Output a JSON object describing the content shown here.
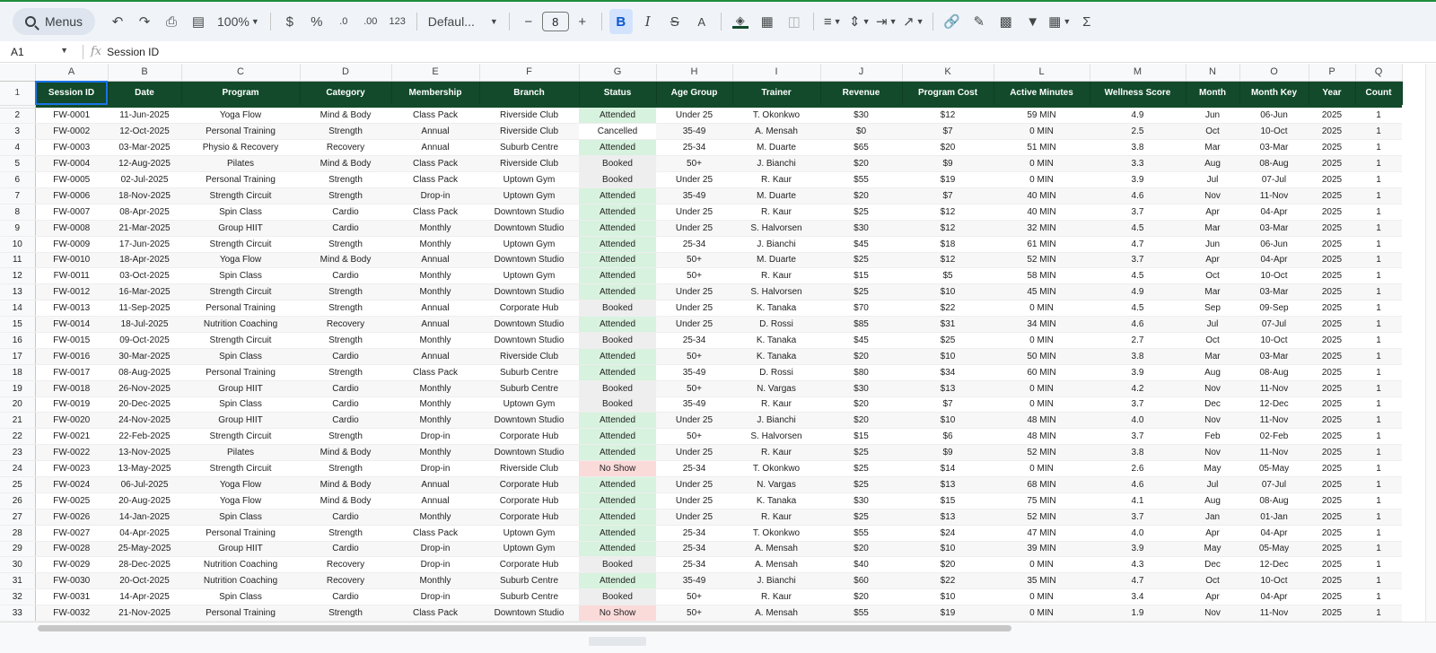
{
  "toolbar": {
    "menus_label": "Menus",
    "zoom": "100%",
    "currency": "$",
    "percent": "%",
    "dec_decrease": ".0",
    "dec_increase": ".00",
    "number_format": "123",
    "font_name": "Defaul...",
    "font_size": "8",
    "bold": "B",
    "italic": "I",
    "strike": "S",
    "text_color": "A",
    "sum": "Σ"
  },
  "formula_bar": {
    "cell_ref": "A1",
    "fx": "fx",
    "value": "Session ID"
  },
  "columns": [
    "A",
    "B",
    "C",
    "D",
    "E",
    "F",
    "G",
    "H",
    "I",
    "J",
    "K",
    "L",
    "M",
    "N",
    "O",
    "P",
    "Q"
  ],
  "headers": [
    "Session ID",
    "Date",
    "Program",
    "Category",
    "Membership",
    "Branch",
    "Status",
    "Age Group",
    "Trainer",
    "Revenue",
    "Program Cost",
    "Active Minutes",
    "Wellness Score",
    "Month",
    "Month Key",
    "Year",
    "Count"
  ],
  "rows": [
    [
      "FW-0001",
      "11-Jun-2025",
      "Yoga Flow",
      "Mind & Body",
      "Class Pack",
      "Riverside Club",
      "Attended",
      "Under 25",
      "T. Okonkwo",
      "$30",
      "$12",
      "59 MIN",
      "4.9",
      "Jun",
      "06-Jun",
      "2025",
      "1"
    ],
    [
      "FW-0002",
      "12-Oct-2025",
      "Personal Training",
      "Strength",
      "Annual",
      "Riverside Club",
      "Cancelled",
      "35-49",
      "A. Mensah",
      "$0",
      "$7",
      "0 MIN",
      "2.5",
      "Oct",
      "10-Oct",
      "2025",
      "1"
    ],
    [
      "FW-0003",
      "03-Mar-2025",
      "Physio & Recovery",
      "Recovery",
      "Annual",
      "Suburb Centre",
      "Attended",
      "25-34",
      "M. Duarte",
      "$65",
      "$20",
      "51 MIN",
      "3.8",
      "Mar",
      "03-Mar",
      "2025",
      "1"
    ],
    [
      "FW-0004",
      "12-Aug-2025",
      "Pilates",
      "Mind & Body",
      "Class Pack",
      "Riverside Club",
      "Booked",
      "50+",
      "J. Bianchi",
      "$20",
      "$9",
      "0 MIN",
      "3.3",
      "Aug",
      "08-Aug",
      "2025",
      "1"
    ],
    [
      "FW-0005",
      "02-Jul-2025",
      "Personal Training",
      "Strength",
      "Class Pack",
      "Uptown Gym",
      "Booked",
      "Under 25",
      "R. Kaur",
      "$55",
      "$19",
      "0 MIN",
      "3.9",
      "Jul",
      "07-Jul",
      "2025",
      "1"
    ],
    [
      "FW-0006",
      "18-Nov-2025",
      "Strength Circuit",
      "Strength",
      "Drop-in",
      "Uptown Gym",
      "Attended",
      "35-49",
      "M. Duarte",
      "$20",
      "$7",
      "40 MIN",
      "4.6",
      "Nov",
      "11-Nov",
      "2025",
      "1"
    ],
    [
      "FW-0007",
      "08-Apr-2025",
      "Spin Class",
      "Cardio",
      "Class Pack",
      "Downtown Studio",
      "Attended",
      "Under 25",
      "R. Kaur",
      "$25",
      "$12",
      "40 MIN",
      "3.7",
      "Apr",
      "04-Apr",
      "2025",
      "1"
    ],
    [
      "FW-0008",
      "21-Mar-2025",
      "Group HIIT",
      "Cardio",
      "Monthly",
      "Downtown Studio",
      "Attended",
      "Under 25",
      "S. Halvorsen",
      "$30",
      "$12",
      "32 MIN",
      "4.5",
      "Mar",
      "03-Mar",
      "2025",
      "1"
    ],
    [
      "FW-0009",
      "17-Jun-2025",
      "Strength Circuit",
      "Strength",
      "Monthly",
      "Uptown Gym",
      "Attended",
      "25-34",
      "J. Bianchi",
      "$45",
      "$18",
      "61 MIN",
      "4.7",
      "Jun",
      "06-Jun",
      "2025",
      "1"
    ],
    [
      "FW-0010",
      "18-Apr-2025",
      "Yoga Flow",
      "Mind & Body",
      "Annual",
      "Downtown Studio",
      "Attended",
      "50+",
      "M. Duarte",
      "$25",
      "$12",
      "52 MIN",
      "3.7",
      "Apr",
      "04-Apr",
      "2025",
      "1"
    ],
    [
      "FW-0011",
      "03-Oct-2025",
      "Spin Class",
      "Cardio",
      "Monthly",
      "Uptown Gym",
      "Attended",
      "50+",
      "R. Kaur",
      "$15",
      "$5",
      "58 MIN",
      "4.5",
      "Oct",
      "10-Oct",
      "2025",
      "1"
    ],
    [
      "FW-0012",
      "16-Mar-2025",
      "Strength Circuit",
      "Strength",
      "Monthly",
      "Downtown Studio",
      "Attended",
      "Under 25",
      "S. Halvorsen",
      "$25",
      "$10",
      "45 MIN",
      "4.9",
      "Mar",
      "03-Mar",
      "2025",
      "1"
    ],
    [
      "FW-0013",
      "11-Sep-2025",
      "Personal Training",
      "Strength",
      "Annual",
      "Corporate Hub",
      "Booked",
      "Under 25",
      "K. Tanaka",
      "$70",
      "$22",
      "0 MIN",
      "4.5",
      "Sep",
      "09-Sep",
      "2025",
      "1"
    ],
    [
      "FW-0014",
      "18-Jul-2025",
      "Nutrition Coaching",
      "Recovery",
      "Annual",
      "Downtown Studio",
      "Attended",
      "Under 25",
      "D. Rossi",
      "$85",
      "$31",
      "34 MIN",
      "4.6",
      "Jul",
      "07-Jul",
      "2025",
      "1"
    ],
    [
      "FW-0015",
      "09-Oct-2025",
      "Strength Circuit",
      "Strength",
      "Monthly",
      "Downtown Studio",
      "Booked",
      "25-34",
      "K. Tanaka",
      "$45",
      "$25",
      "0 MIN",
      "2.7",
      "Oct",
      "10-Oct",
      "2025",
      "1"
    ],
    [
      "FW-0016",
      "30-Mar-2025",
      "Spin Class",
      "Cardio",
      "Annual",
      "Riverside Club",
      "Attended",
      "50+",
      "K. Tanaka",
      "$20",
      "$10",
      "50 MIN",
      "3.8",
      "Mar",
      "03-Mar",
      "2025",
      "1"
    ],
    [
      "FW-0017",
      "08-Aug-2025",
      "Personal Training",
      "Strength",
      "Class Pack",
      "Suburb Centre",
      "Attended",
      "35-49",
      "D. Rossi",
      "$80",
      "$34",
      "60 MIN",
      "3.9",
      "Aug",
      "08-Aug",
      "2025",
      "1"
    ],
    [
      "FW-0018",
      "26-Nov-2025",
      "Group HIIT",
      "Cardio",
      "Monthly",
      "Suburb Centre",
      "Booked",
      "50+",
      "N. Vargas",
      "$30",
      "$13",
      "0 MIN",
      "4.2",
      "Nov",
      "11-Nov",
      "2025",
      "1"
    ],
    [
      "FW-0019",
      "20-Dec-2025",
      "Spin Class",
      "Cardio",
      "Monthly",
      "Uptown Gym",
      "Booked",
      "35-49",
      "R. Kaur",
      "$20",
      "$7",
      "0 MIN",
      "3.7",
      "Dec",
      "12-Dec",
      "2025",
      "1"
    ],
    [
      "FW-0020",
      "24-Nov-2025",
      "Group HIIT",
      "Cardio",
      "Monthly",
      "Downtown Studio",
      "Attended",
      "Under 25",
      "J. Bianchi",
      "$20",
      "$10",
      "48 MIN",
      "4.0",
      "Nov",
      "11-Nov",
      "2025",
      "1"
    ],
    [
      "FW-0021",
      "22-Feb-2025",
      "Strength Circuit",
      "Strength",
      "Drop-in",
      "Corporate Hub",
      "Attended",
      "50+",
      "S. Halvorsen",
      "$15",
      "$6",
      "48 MIN",
      "3.7",
      "Feb",
      "02-Feb",
      "2025",
      "1"
    ],
    [
      "FW-0022",
      "13-Nov-2025",
      "Pilates",
      "Mind & Body",
      "Monthly",
      "Downtown Studio",
      "Attended",
      "Under 25",
      "R. Kaur",
      "$25",
      "$9",
      "52 MIN",
      "3.8",
      "Nov",
      "11-Nov",
      "2025",
      "1"
    ],
    [
      "FW-0023",
      "13-May-2025",
      "Strength Circuit",
      "Strength",
      "Drop-in",
      "Riverside Club",
      "No Show",
      "25-34",
      "T. Okonkwo",
      "$25",
      "$14",
      "0 MIN",
      "2.6",
      "May",
      "05-May",
      "2025",
      "1"
    ],
    [
      "FW-0024",
      "06-Jul-2025",
      "Yoga Flow",
      "Mind & Body",
      "Annual",
      "Corporate Hub",
      "Attended",
      "Under 25",
      "N. Vargas",
      "$25",
      "$13",
      "68 MIN",
      "4.6",
      "Jul",
      "07-Jul",
      "2025",
      "1"
    ],
    [
      "FW-0025",
      "20-Aug-2025",
      "Yoga Flow",
      "Mind & Body",
      "Annual",
      "Corporate Hub",
      "Attended",
      "Under 25",
      "K. Tanaka",
      "$30",
      "$15",
      "75 MIN",
      "4.1",
      "Aug",
      "08-Aug",
      "2025",
      "1"
    ],
    [
      "FW-0026",
      "14-Jan-2025",
      "Spin Class",
      "Cardio",
      "Monthly",
      "Corporate Hub",
      "Attended",
      "Under 25",
      "R. Kaur",
      "$25",
      "$13",
      "52 MIN",
      "3.7",
      "Jan",
      "01-Jan",
      "2025",
      "1"
    ],
    [
      "FW-0027",
      "04-Apr-2025",
      "Personal Training",
      "Strength",
      "Class Pack",
      "Uptown Gym",
      "Attended",
      "25-34",
      "T. Okonkwo",
      "$55",
      "$24",
      "47 MIN",
      "4.0",
      "Apr",
      "04-Apr",
      "2025",
      "1"
    ],
    [
      "FW-0028",
      "25-May-2025",
      "Group HIIT",
      "Cardio",
      "Drop-in",
      "Uptown Gym",
      "Attended",
      "25-34",
      "A. Mensah",
      "$20",
      "$10",
      "39 MIN",
      "3.9",
      "May",
      "05-May",
      "2025",
      "1"
    ],
    [
      "FW-0029",
      "28-Dec-2025",
      "Nutrition Coaching",
      "Recovery",
      "Drop-in",
      "Corporate Hub",
      "Booked",
      "25-34",
      "A. Mensah",
      "$40",
      "$20",
      "0 MIN",
      "4.3",
      "Dec",
      "12-Dec",
      "2025",
      "1"
    ],
    [
      "FW-0030",
      "20-Oct-2025",
      "Nutrition Coaching",
      "Recovery",
      "Monthly",
      "Suburb Centre",
      "Attended",
      "35-49",
      "J. Bianchi",
      "$60",
      "$22",
      "35 MIN",
      "4.7",
      "Oct",
      "10-Oct",
      "2025",
      "1"
    ],
    [
      "FW-0031",
      "14-Apr-2025",
      "Spin Class",
      "Cardio",
      "Drop-in",
      "Suburb Centre",
      "Booked",
      "50+",
      "R. Kaur",
      "$20",
      "$10",
      "0 MIN",
      "3.4",
      "Apr",
      "04-Apr",
      "2025",
      "1"
    ],
    [
      "FW-0032",
      "21-Nov-2025",
      "Personal Training",
      "Strength",
      "Class Pack",
      "Downtown Studio",
      "No Show",
      "50+",
      "A. Mensah",
      "$55",
      "$19",
      "0 MIN",
      "1.9",
      "Nov",
      "11-Nov",
      "2025",
      "1"
    ]
  ],
  "colors": {
    "header_bg": "#124a2b",
    "attended": "#d7f2de",
    "booked": "#eeeeee",
    "no_show": "#fbdada",
    "accent": "#1a73e8"
  }
}
